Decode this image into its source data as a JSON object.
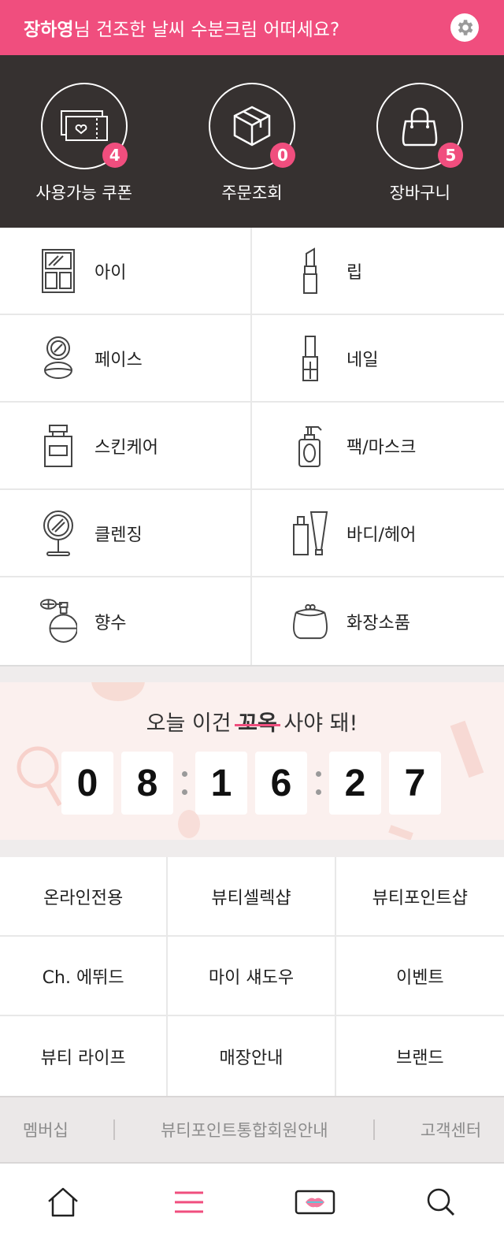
{
  "greeting": {
    "user_name": "장하영",
    "message": "님 건조한 날씨 수분크림 어떠세요?"
  },
  "summary": [
    {
      "label": "사용가능 쿠폰",
      "count": "4",
      "icon": "coupon-icon"
    },
    {
      "label": "주문조회",
      "count": "0",
      "icon": "box-icon"
    },
    {
      "label": "장바구니",
      "count": "5",
      "icon": "shopping-bag-icon"
    }
  ],
  "categories": [
    {
      "label": "아이",
      "icon": "eyeshadow-palette-icon"
    },
    {
      "label": "립",
      "icon": "lipstick-icon"
    },
    {
      "label": "페이스",
      "icon": "compact-icon"
    },
    {
      "label": "네일",
      "icon": "nail-polish-icon"
    },
    {
      "label": "스킨케어",
      "icon": "skincare-bottle-icon"
    },
    {
      "label": "팩/마스크",
      "icon": "pump-bottle-icon"
    },
    {
      "label": "클렌징",
      "icon": "mirror-icon"
    },
    {
      "label": "바디/헤어",
      "icon": "body-hair-tubes-icon"
    },
    {
      "label": "향수",
      "icon": "perfume-icon"
    },
    {
      "label": "화장소품",
      "icon": "pouch-icon"
    }
  ],
  "deal": {
    "title_before": "오늘 이건 ",
    "title_emphasis": "꼬옥",
    "title_after": " 사야 돼!",
    "digits": [
      "0",
      "8",
      "1",
      "6",
      "2",
      "7"
    ]
  },
  "menu": [
    "온라인전용",
    "뷰티셀렉샵",
    "뷰티포인트샵",
    "Ch. 에뛰드",
    "마이 섀도우",
    "이벤트",
    "뷰티 라이프",
    "매장안내",
    "브랜드"
  ],
  "footer_links": [
    "멤버십",
    "뷰티포인트통합회원안내",
    "고객센터"
  ],
  "bottom_nav": [
    {
      "icon": "home-icon"
    },
    {
      "icon": "menu-icon"
    },
    {
      "icon": "lips-card-icon"
    },
    {
      "icon": "search-icon"
    }
  ],
  "colors": {
    "accent": "#f04e7e",
    "dark": "#363130"
  }
}
